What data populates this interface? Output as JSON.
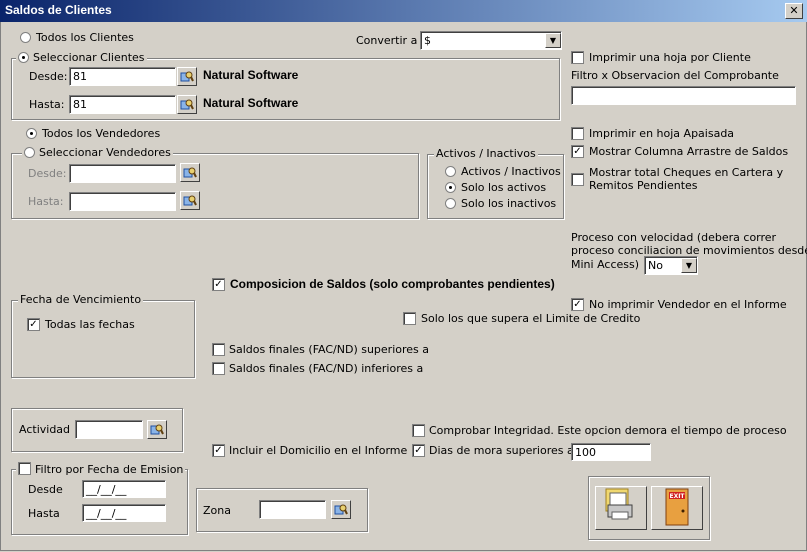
{
  "window": {
    "title": "Saldos de Clientes",
    "close_glyph": "✕"
  },
  "clientes": {
    "todos_label": "Todos los Clientes",
    "seleccionar_label": "Seleccionar Clientes",
    "desde_label": "Desde:",
    "desde_value": "81",
    "desde_name": "Natural Software",
    "hasta_label": "Hasta:",
    "hasta_value": "81",
    "hasta_name": "Natural Software"
  },
  "convertir": {
    "label": "Convertir a",
    "value": "$"
  },
  "vendedores": {
    "todos_label": "Todos los Vendedores",
    "seleccionar_label": "Seleccionar Vendedores",
    "desde_label": "Desde:",
    "hasta_label": "Hasta:",
    "desde_value": "",
    "hasta_value": ""
  },
  "activos": {
    "title": "Activos / Inactivos",
    "opt_all": "Activos / Inactivos",
    "opt_activos": "Solo los activos",
    "opt_inactivos": "Solo los inactivos"
  },
  "right": {
    "imprimir_hoja": "Imprimir una hoja por Cliente",
    "filtro_obs_label": "Filtro x Observacion del Comprobante",
    "filtro_obs_value": "",
    "apaisada": "Imprimir en hoja Apaisada",
    "arrastre": "Mostrar Columna Arrastre de Saldos",
    "cheques_line1": "Mostrar total Cheques en Cartera y",
    "cheques_line2": "Remitos Pendientes",
    "proceso_line1": "Proceso con velocidad (debera correr",
    "proceso_line2": "proceso conciliacion de movimientos desde",
    "proceso_line3": "Mini Access)",
    "proceso_value": "No",
    "no_vendedor": "No imprimir Vendedor en el Informe"
  },
  "composicion": {
    "label": "Composicion de Saldos (solo comprobantes pendientes)"
  },
  "limite": {
    "label": "Solo los que supera el Limite de Credito"
  },
  "vencimiento": {
    "title": "Fecha de Vencimiento",
    "todas_label": "Todas las fechas"
  },
  "saldos": {
    "superiores": "Saldos finales (FAC/ND) superiores a",
    "inferiores": "Saldos finales (FAC/ND) inferiores a"
  },
  "actividad": {
    "label": "Actividad",
    "value": ""
  },
  "domicilio": {
    "label": "Incluir el Domicilio en el Informe"
  },
  "integridad": {
    "label": "Comprobar Integridad. Este opcion demora el tiempo de proceso"
  },
  "mora": {
    "label": "Dias de mora superiores a",
    "value": "100"
  },
  "emision": {
    "title": "Filtro por Fecha de Emision",
    "desde_label": "Desde",
    "desde_value": "__/__/__",
    "hasta_label": "Hasta",
    "hasta_value": "__/__/__"
  },
  "zona": {
    "label": "Zona",
    "value": ""
  },
  "actions": {
    "exit_text": "EXIT"
  }
}
